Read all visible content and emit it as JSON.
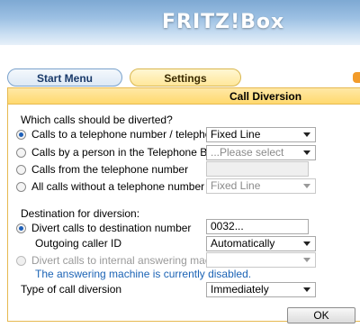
{
  "header": {
    "logo_text": "FRITZ!Box"
  },
  "tabs": {
    "start_menu": "Start Menu",
    "settings": "Settings"
  },
  "panel": {
    "title": "Call Diversion"
  },
  "which_calls": {
    "heading": "Which calls should be diverted?",
    "options": [
      {
        "label": "Calls to a telephone number / telephone",
        "selected": true,
        "control_value": "Fixed Line"
      },
      {
        "label": "Calls by a person in the Telephone Book",
        "selected": false,
        "control_value": "...Please select"
      },
      {
        "label": "Calls from the telephone number",
        "selected": false,
        "control_value": ""
      },
      {
        "label": "All calls without a telephone number to",
        "selected": false,
        "control_value": "Fixed Line"
      }
    ]
  },
  "destination": {
    "heading": "Destination for diversion:",
    "divert_number_label": "Divert calls to destination number",
    "divert_number_value": "0032...",
    "caller_id_label": "Outgoing caller ID",
    "caller_id_value": "Automatically",
    "answering_machine_label": "Divert calls to internal answering machine",
    "answering_machine_value": "",
    "answering_machine_note": "The answering machine is currently disabled."
  },
  "type": {
    "label": "Type of call diversion",
    "value": "Immediately"
  },
  "buttons": {
    "ok": "OK"
  },
  "colors": {
    "accent_blue": "#1b63b5",
    "panel_border": "#e6b950",
    "title_bar": "#ffd96e"
  }
}
